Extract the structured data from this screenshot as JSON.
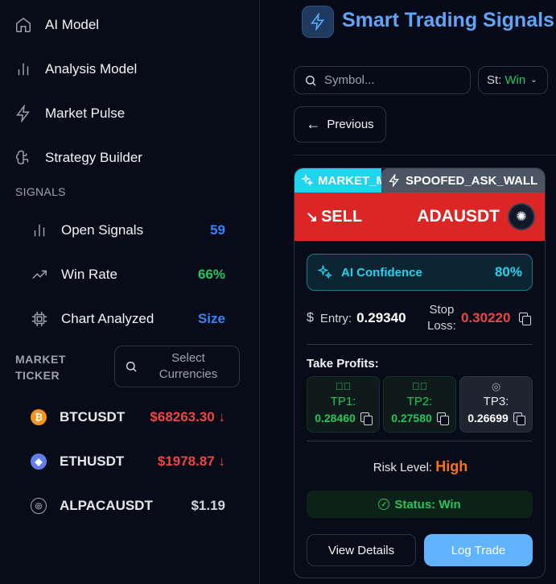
{
  "sidebar": {
    "nav": [
      {
        "label": "AI Model",
        "icon": "home-icon"
      },
      {
        "label": "Analysis Model",
        "icon": "bar-chart-icon"
      },
      {
        "label": "Market Pulse",
        "icon": "lightning-icon"
      },
      {
        "label": "Strategy Builder",
        "icon": "brain-icon"
      }
    ],
    "signals_heading": "SIGNALS",
    "signals": [
      {
        "label": "Open Signals",
        "value": "59",
        "color": "#3b82f6"
      },
      {
        "label": "Win Rate",
        "value": "66%",
        "color": "#22c55e"
      },
      {
        "label": "Chart Analyzed",
        "value": "Size",
        "color": "#3b82f6"
      }
    ],
    "ticker_heading_1": "MARKET",
    "ticker_heading_2": "TICKER",
    "select_currencies_1": "Select",
    "select_currencies_2": "Currencies",
    "tickers": [
      {
        "symbol": "BTCUSDT",
        "price": "$68263.30 ↓",
        "color": "#ef4444",
        "coin_color": "#f7931a"
      },
      {
        "symbol": "ETHUSDT",
        "price": "$1978.87 ↓",
        "color": "#ef4444",
        "coin_color": "#627eea"
      },
      {
        "symbol": "ALPACAUSDT",
        "price": "$1.19",
        "color": "#d1d5db",
        "coin_color": "#9ca3af"
      }
    ]
  },
  "main": {
    "title": "Smart Trading Signals",
    "search_placeholder": "Symbol...",
    "status_prefix": "St:",
    "status_value": "Win",
    "previous_label": "Previous",
    "card": {
      "tag1": "MARKET_M",
      "tag2": "SPOOFED_ASK_WALL",
      "direction": "SELL",
      "pair": "ADAUSDT",
      "confidence_label": "AI Confidence",
      "confidence_value": "80%",
      "entry_label": "Entry:",
      "entry_value": "0.29340",
      "stop_label_1": "Stop",
      "stop_label_2": "Loss:",
      "stop_value": "0.30220",
      "take_profits_label": "Take Profits:",
      "tps": [
        {
          "name": "TP1:",
          "value": "0.28460",
          "hit": true
        },
        {
          "name": "TP2:",
          "value": "0.27580",
          "hit": true
        },
        {
          "name": "TP3:",
          "value": "0.26699",
          "hit": false
        }
      ],
      "risk_label": "Risk Level:",
      "risk_value": "High",
      "status_text": "Status: Win",
      "details_label": "View Details",
      "log_label": "Log Trade"
    }
  }
}
